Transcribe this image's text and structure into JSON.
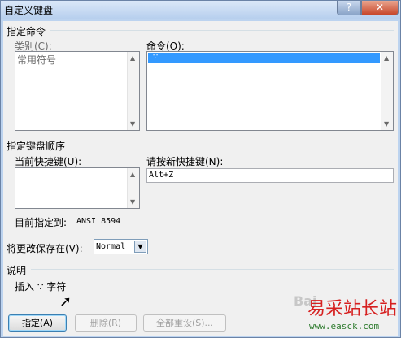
{
  "window": {
    "title": "自定义键盘",
    "help_label": "?",
    "close_label": "✕"
  },
  "specify_command": {
    "group_label": "指定命令",
    "category_label": "类别(C):",
    "categories": [
      "常用符号"
    ],
    "command_label": "命令(O):",
    "commands": [
      "∵"
    ]
  },
  "key_sequence": {
    "group_label": "指定键盘顺序",
    "current_keys_label": "当前快捷键(U):",
    "new_key_label": "请按新快捷键(N):",
    "new_key_value": "Alt+Z",
    "assigned_to_label": "目前指定到:",
    "assigned_to_value": "ANSI 8594"
  },
  "save_changes": {
    "label": "将更改保存在(V):",
    "value": "Normal"
  },
  "description": {
    "group_label": "说明",
    "text": "插入 ∵ 字符"
  },
  "buttons": {
    "assign": "指定(A)",
    "remove": "删除(R)",
    "reset_all": "全部重设(S)..."
  },
  "watermark": {
    "text_gray": "Bai",
    "text_red": "易采站长站",
    "text_url": "www.easck.com"
  }
}
